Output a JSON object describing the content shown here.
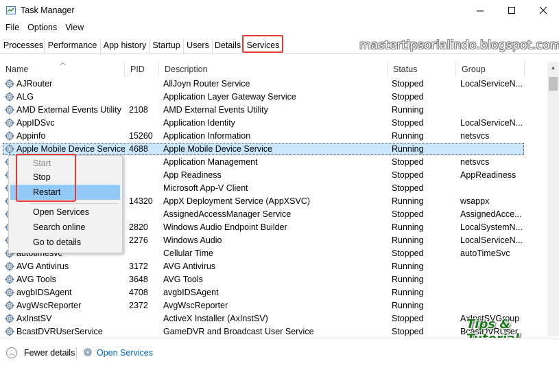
{
  "window": {
    "title": "Task Manager"
  },
  "menu": [
    "File",
    "Options",
    "View"
  ],
  "tabs": [
    "Processes",
    "Performance",
    "App history",
    "Startup",
    "Users",
    "Details",
    "Services"
  ],
  "watermark": "mastertipsorialindo.blogspot.com",
  "brand": "Tips & Tutorial",
  "columns": {
    "name": "Name",
    "pid": "PID",
    "description": "Description",
    "status": "Status",
    "group": "Group"
  },
  "rows": [
    {
      "name": "AJRouter",
      "pid": "",
      "description": "AllJoyn Router Service",
      "status": "Stopped",
      "group": "LocalServiceN..."
    },
    {
      "name": "ALG",
      "pid": "",
      "description": "Application Layer Gateway Service",
      "status": "Stopped",
      "group": ""
    },
    {
      "name": "AMD External Events Utility",
      "pid": "2108",
      "description": "AMD External Events Utility",
      "status": "Running",
      "group": ""
    },
    {
      "name": "AppIDSvc",
      "pid": "",
      "description": "Application Identity",
      "status": "Stopped",
      "group": "LocalServiceN..."
    },
    {
      "name": "Appinfo",
      "pid": "15260",
      "description": "Application Information",
      "status": "Running",
      "group": "netsvcs"
    },
    {
      "name": "Apple Mobile Device Service",
      "pid": "4688",
      "description": "Apple Mobile Device Service",
      "status": "Running",
      "group": ""
    },
    {
      "name": "",
      "pid": "",
      "description": "Application Management",
      "status": "Stopped",
      "group": "netsvcs"
    },
    {
      "name": "",
      "pid": "",
      "description": "App Readiness",
      "status": "Stopped",
      "group": "AppReadiness"
    },
    {
      "name": "",
      "pid": "",
      "description": "Microsoft App-V Client",
      "status": "Stopped",
      "group": ""
    },
    {
      "name": "",
      "pid": "14320",
      "description": "AppX Deployment Service (AppXSVC)",
      "status": "Running",
      "group": "wsappx"
    },
    {
      "name": "",
      "pid": "",
      "description": "AssignedAccessManager Service",
      "status": "Stopped",
      "group": "AssignedAcce..."
    },
    {
      "name": "",
      "pid": "2820",
      "description": "Windows Audio Endpoint Builder",
      "status": "Running",
      "group": "LocalSystemN..."
    },
    {
      "name": "",
      "pid": "2276",
      "description": "Windows Audio",
      "status": "Running",
      "group": "LocalServiceN..."
    },
    {
      "name": "autotimesvc",
      "pid": "",
      "description": "Cellular Time",
      "status": "Stopped",
      "group": "autoTimeSvc"
    },
    {
      "name": "AVG Antivirus",
      "pid": "3172",
      "description": "AVG Antivirus",
      "status": "Running",
      "group": ""
    },
    {
      "name": "AVG Tools",
      "pid": "3648",
      "description": "AVG Tools",
      "status": "Running",
      "group": ""
    },
    {
      "name": "avgbIDSAgent",
      "pid": "4708",
      "description": "avgbIDSAgent",
      "status": "Running",
      "group": ""
    },
    {
      "name": "AvgWscReporter",
      "pid": "2372",
      "description": "AvgWscReporter",
      "status": "Running",
      "group": ""
    },
    {
      "name": "AxInstSV",
      "pid": "",
      "description": "ActiveX Installer (AxInstSV)",
      "status": "Stopped",
      "group": "AxInstSVGroup"
    },
    {
      "name": "BcastDVRUserService",
      "pid": "",
      "description": "GameDVR and Broadcast User Service",
      "status": "Stopped",
      "group": "BcastDVRUser..."
    }
  ],
  "context_menu": [
    "Start",
    "Stop",
    "Restart",
    "Open Services",
    "Search online",
    "Go to details"
  ],
  "footer": {
    "fewer_details": "Fewer details",
    "open_services": "Open Services"
  }
}
